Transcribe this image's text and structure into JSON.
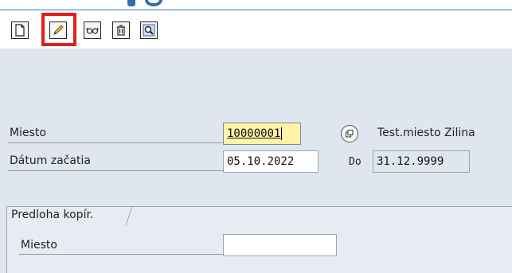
{
  "toolbar": {
    "buttons": [
      {
        "name": "new-icon"
      },
      {
        "name": "pencil-icon"
      },
      {
        "name": "glasses-icon"
      },
      {
        "name": "trash-icon"
      },
      {
        "name": "magnify-icon"
      }
    ],
    "highlight_color": "#e02020"
  },
  "form": {
    "miesto_label": "Miesto",
    "miesto_value": "10000001",
    "miesto_desc": "Test.miesto Zilina",
    "datum_label": "Dátum začatia",
    "datum_from": "05.10.2022",
    "do_label": "Do",
    "datum_to": "31.12.9999"
  },
  "copy_template": {
    "tab_label": "Predloha kopír.",
    "miesto_label": "Miesto",
    "miesto_value": ""
  },
  "colors": {
    "accent": "#2f6fb0",
    "required_field": "#fff3a8",
    "background": "#dfe6ef"
  }
}
